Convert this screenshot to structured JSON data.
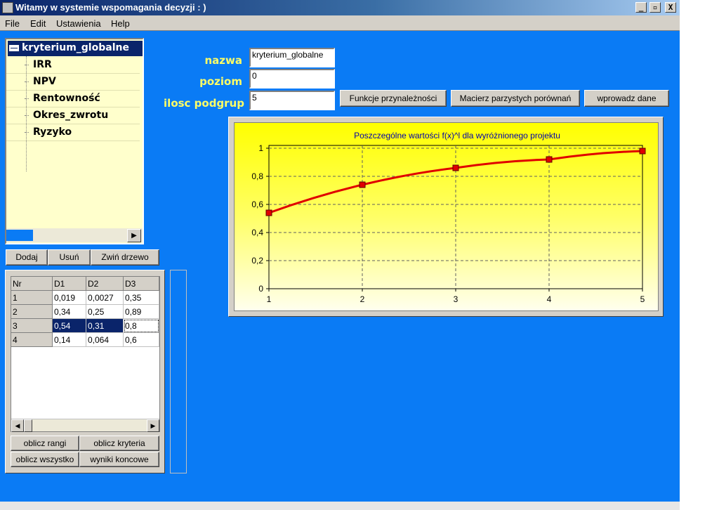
{
  "window": {
    "title": "Witamy w systemie wspomagania decyzji : )"
  },
  "window_buttons": {
    "minimize": "_",
    "maximize": "▫",
    "close": "X"
  },
  "menu": [
    {
      "label": "File"
    },
    {
      "label": "Edit"
    },
    {
      "label": "Ustawienia"
    },
    {
      "label": "Help"
    }
  ],
  "tree": {
    "root": "kryterium_globalne",
    "children": [
      "IRR",
      "NPV",
      "Rentowność",
      "Okres_zwrotu",
      "Ryzyko"
    ]
  },
  "tree_buttons": {
    "add": "Dodaj",
    "remove": "Usuń",
    "collapse": "Zwiń drzewo"
  },
  "form": {
    "name_label": "nazwa",
    "name_value": "kryterium_globalne",
    "level_label": "poziom",
    "level_value": "0",
    "subgroups_label": "ilosc podgrup",
    "subgroups_value": "5"
  },
  "action_buttons": {
    "membership": "Funkcje przynależności",
    "pairwise": "Macierz parzystych porównań",
    "enter_data": "wprowadz dane"
  },
  "grid": {
    "headers": [
      "Nr",
      "D1",
      "D2",
      "D3"
    ],
    "rows": [
      [
        "1",
        "0,019",
        "0,0027",
        "0,35"
      ],
      [
        "2",
        "0,34",
        "0,25",
        "0,89"
      ],
      [
        "3",
        "0,54",
        "0,31",
        "0,8"
      ],
      [
        "4",
        "0,14",
        "0,064",
        "0,6"
      ]
    ],
    "selected_row": 2
  },
  "grid_buttons": {
    "ranks": "oblicz rangi",
    "criteria": "oblicz kryteria",
    "all": "oblicz wszystko",
    "results": "wyniki koncowe"
  },
  "colors": {
    "background": "#0a7bf5",
    "label": "#ffff66",
    "series": "#e00000"
  },
  "chart_data": {
    "type": "line",
    "title": "Poszczególne wartości f(x)^l dla wyróżnionego projektu",
    "x": [
      1,
      2,
      3,
      4,
      5
    ],
    "values": [
      0.54,
      0.74,
      0.86,
      0.92,
      0.98
    ],
    "xlim": [
      1,
      5
    ],
    "ylim": [
      0,
      1
    ],
    "xticks": [
      "1",
      "2",
      "3",
      "4",
      "5"
    ],
    "yticks": [
      "0",
      "0,2",
      "0,4",
      "0,6",
      "0,8",
      "1"
    ],
    "grid": true,
    "xlabel": "",
    "ylabel": ""
  }
}
